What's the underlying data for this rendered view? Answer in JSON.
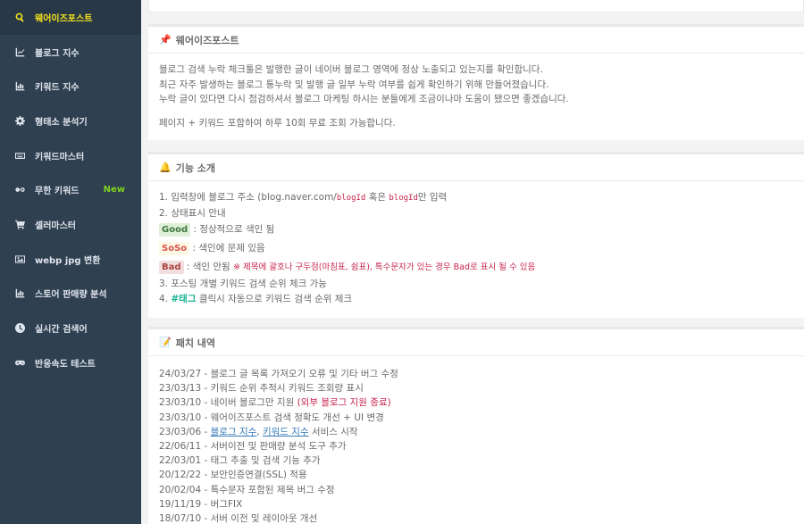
{
  "sidebar": {
    "items": [
      {
        "label": "웨어이즈포스트",
        "icon": "search-icon",
        "active": true
      },
      {
        "label": "블로그 지수",
        "icon": "line-chart-icon"
      },
      {
        "label": "키워드 지수",
        "icon": "bar-chart-icon"
      },
      {
        "label": "형태소 분석기",
        "icon": "gear-icon"
      },
      {
        "label": "키워드마스터",
        "icon": "keyboard-icon"
      },
      {
        "label": "무한 키워드",
        "icon": "infinity-icon",
        "badge": "New"
      },
      {
        "label": "셀러마스터",
        "icon": "cart-icon"
      },
      {
        "label": "webp jpg 변환",
        "icon": "image-icon"
      },
      {
        "label": "스토어 판매량 분석",
        "icon": "bar-chart-icon"
      },
      {
        "label": "실시간 검색어",
        "icon": "clock-icon"
      },
      {
        "label": "반응속도 테스트",
        "icon": "gamepad-icon"
      }
    ],
    "colors": {
      "bg": "#2f4050",
      "active_text": "#f8e71c",
      "badge": "#7ed321"
    }
  },
  "intro": {
    "title": "웨어이즈포스트",
    "icon": "pushpin-icon",
    "lines": [
      "블로그 검색 누락 체크툴은 발행한 글이 네이버 블로그 영역에 정상 노출되고 있는지를 확인합니다.",
      "최근 자주 발생하는 블로그 통누락 및 발행 글 일부 누락 여부를 쉽게 확인하기 위해 만들어졌습니다.",
      "누락 글이 있다면 다시 점검하셔서 블로그 마케팅 하시는 분들에게 조금이나마 도움이 됐으면 좋겠습니다."
    ],
    "limit": "페이지 + 키워드 포함하여 하루 10회 무료 조회 가능합니다."
  },
  "features": {
    "title": "기능 소개",
    "icon": "bell-icon",
    "item1_prefix": "1. 입력창에 블로그 주소 (blog.naver.com/",
    "item1_code1": "blogId",
    "item1_mid": " 혹은 ",
    "item1_code2": "blogId",
    "item1_suffix": "만 입력",
    "item2": "2. 상태표시 안내",
    "good_badge": "Good",
    "good_text": " : 정상적으로 색인 됨",
    "soso_badge": "SoSo",
    "soso_text": " : 색인에 문제 있음",
    "bad_badge": "Bad",
    "bad_text": " : 색인 안됨 ",
    "bad_warn": "※ 제목에 괄호나 구두점(마침표, 쉼표), 특수문자가 있는 경우 Bad로 표시 될 수 있음",
    "item3": "3. 포스팅 개별 키워드 검색 순위 체크 가능",
    "item4_prefix": "4. ",
    "item4_tag": "#태그",
    "item4_suffix": " 클릭시 자동으로 키워드 검색 순위 체크"
  },
  "patch": {
    "title": "패치 내역",
    "icon": "memo-icon",
    "l1": "24/03/27 - 블로그 글 목록 가져오기 오류 및 기타 버그 수정",
    "l2": "23/03/13 - 키워드 순위 추적시 키워드 조회량 표시",
    "l3_prefix": "23/03/10 - 네이버 블로그만 지원 ",
    "l3_warn": "(외부 블로그 지원 종료)",
    "l4": "23/03/10 - 웨어이즈포스트 검색 정확도 개선 + UI 변경",
    "l5_prefix": "23/03/06 - ",
    "l5_link1": "블로그 지수",
    "l5_sep": ", ",
    "l5_link2": "키워드 지수",
    "l5_suffix": " 서비스 시작",
    "l6": "22/06/11 - 서버이전 및 판매량 분석 도구 추가",
    "l7": "22/03/01 - 태그 추출 및 검색 기능 추가",
    "l8": "20/12/22 - 보안인증연결(SSL) 적용",
    "l9": "20/02/04 - 특수문자 포함된 제목 버그 수정",
    "l10": "19/11/19 - 버그FIX",
    "l11": "18/07/10 - 서버 이전 및 레이아웃 개선"
  }
}
